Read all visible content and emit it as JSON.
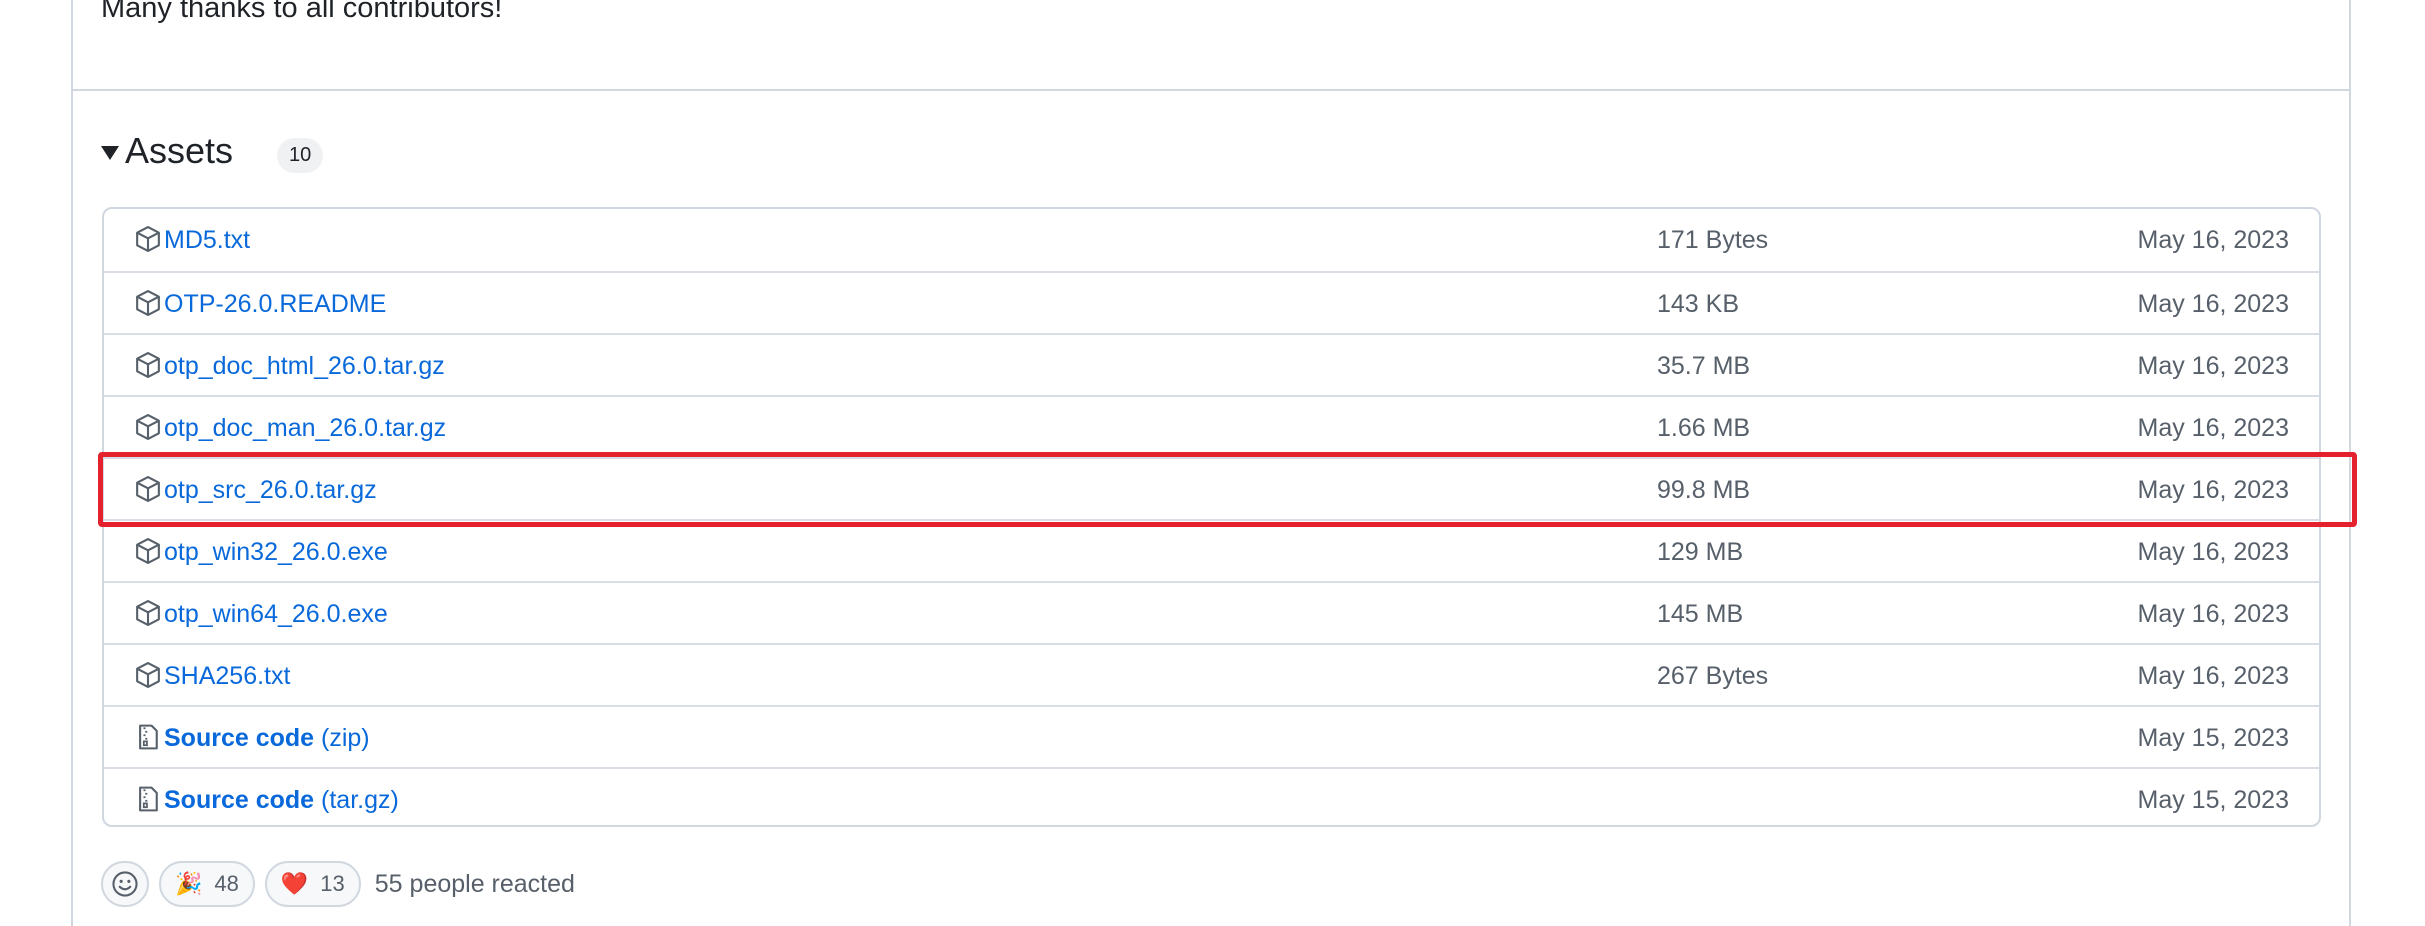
{
  "release": {
    "thanks_text": "Many thanks to all contributors!"
  },
  "assets": {
    "title": "Assets",
    "count": "10",
    "items": [
      {
        "name": "MD5.txt",
        "suffix": "",
        "size": "171 Bytes",
        "date": "May 16, 2023",
        "icon": "package-icon"
      },
      {
        "name": "OTP-26.0.README",
        "suffix": "",
        "size": "143 KB",
        "date": "May 16, 2023",
        "icon": "package-icon"
      },
      {
        "name": "otp_doc_html_26.0.tar.gz",
        "suffix": "",
        "size": "35.7 MB",
        "date": "May 16, 2023",
        "icon": "package-icon"
      },
      {
        "name": "otp_doc_man_26.0.tar.gz",
        "suffix": "",
        "size": "1.66 MB",
        "date": "May 16, 2023",
        "icon": "package-icon"
      },
      {
        "name": "otp_src_26.0.tar.gz",
        "suffix": "",
        "size": "99.8 MB",
        "date": "May 16, 2023",
        "icon": "package-icon"
      },
      {
        "name": "otp_win32_26.0.exe",
        "suffix": "",
        "size": "129 MB",
        "date": "May 16, 2023",
        "icon": "package-icon"
      },
      {
        "name": "otp_win64_26.0.exe",
        "suffix": "",
        "size": "145 MB",
        "date": "May 16, 2023",
        "icon": "package-icon"
      },
      {
        "name": "SHA256.txt",
        "suffix": "",
        "size": "267 Bytes",
        "date": "May 16, 2023",
        "icon": "package-icon"
      },
      {
        "name": "Source code",
        "suffix": "(zip)",
        "size": "",
        "date": "May 15, 2023",
        "icon": "file-zip-icon"
      },
      {
        "name": "Source code",
        "suffix": "(tar.gz)",
        "size": "",
        "date": "May 15, 2023",
        "icon": "file-zip-icon"
      }
    ]
  },
  "reactions": {
    "hooray_emoji": "🎉",
    "hooray_count": "48",
    "heart_emoji": "❤️",
    "heart_count": "13",
    "summary": "55 people reacted"
  },
  "colors": {
    "link": "#0969da",
    "highlight": "#e3222d",
    "muted": "#57606a",
    "border": "#d0d7de"
  }
}
